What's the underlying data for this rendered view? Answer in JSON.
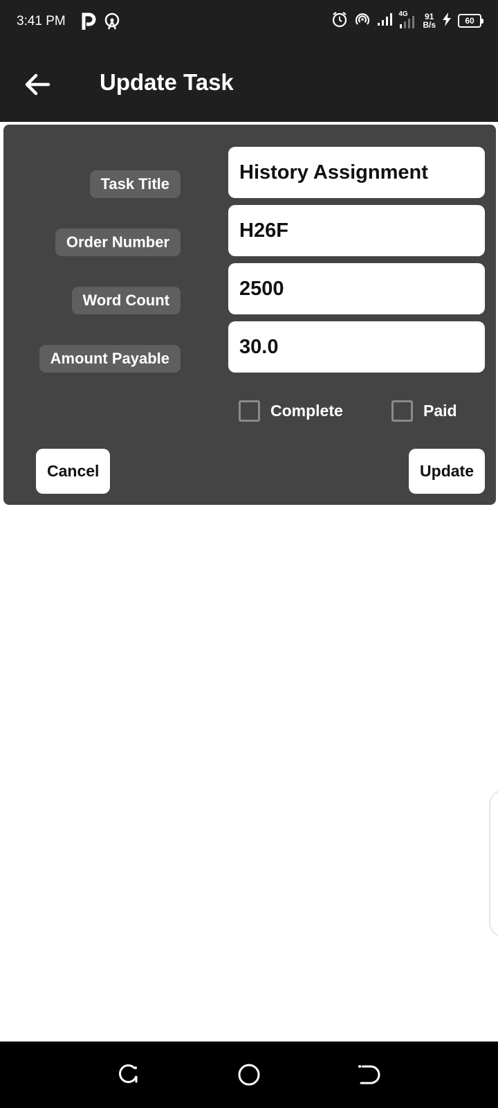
{
  "status_bar": {
    "time": "3:41 PM",
    "network_type": "4G",
    "speed_value": "91",
    "speed_unit": "B/s",
    "battery": "60",
    "icons": [
      "parking-p-icon",
      "hotspot-icon",
      "alarm-icon",
      "hotspot-icon",
      "signal-icon",
      "signal-4g-icon",
      "charging-bolt-icon",
      "battery-icon"
    ]
  },
  "app_bar": {
    "title": "Update Task",
    "back_icon": "arrow-left-icon"
  },
  "form": {
    "fields": [
      {
        "label": "Task Title",
        "value": "History Assignment"
      },
      {
        "label": "Order Number",
        "value": "H26F"
      },
      {
        "label": "Word Count",
        "value": "2500"
      },
      {
        "label": "Amount Payable",
        "value": "30.0"
      }
    ],
    "checkboxes": [
      {
        "label": "Complete",
        "checked": false
      },
      {
        "label": "Paid",
        "checked": false
      }
    ],
    "cancel_label": "Cancel",
    "update_label": "Update"
  },
  "colors": {
    "bar_background": "#1f1f1f",
    "card_background": "#444444",
    "label_chip": "#5f5f5f",
    "nav_background": "#000000"
  },
  "nav_bar": {
    "icons": [
      "recent-apps-icon",
      "home-circle-icon",
      "back-nav-icon"
    ]
  }
}
